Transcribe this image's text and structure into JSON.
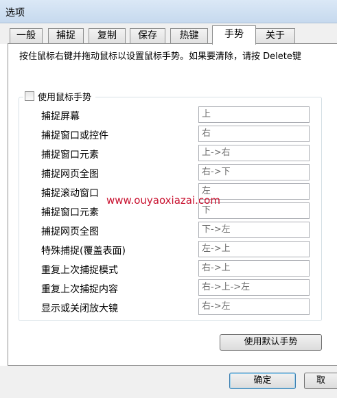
{
  "window": {
    "title": "选项"
  },
  "tabs": [
    {
      "label": "一般"
    },
    {
      "label": "捕捉"
    },
    {
      "label": "复制"
    },
    {
      "label": "保存"
    },
    {
      "label": "热键"
    },
    {
      "label": "手势"
    },
    {
      "label": "关于"
    }
  ],
  "active_tab": "手势",
  "gesture": {
    "description": "按住鼠标右键并拖动鼠标以设置鼠标手势。如果要清除，请按 Delete键",
    "enable_label": "使用鼠标手势",
    "enabled": false,
    "rows": [
      {
        "label": "捕捉屏幕",
        "value": "上"
      },
      {
        "label": "捕捉窗口或控件",
        "value": "右"
      },
      {
        "label": "捕捉窗口元素",
        "value": "上->右"
      },
      {
        "label": "捕捉网页全图",
        "value": "右->下"
      },
      {
        "label": "捕捉滚动窗口",
        "value": "左"
      },
      {
        "label": "捕捉窗口元素",
        "value": "下"
      },
      {
        "label": "捕捉网页全图",
        "value": "下->左"
      },
      {
        "label": "特殊捕捉(覆盖表面)",
        "value": "左->上"
      },
      {
        "label": "重复上次捕捉模式",
        "value": "右->上"
      },
      {
        "label": "重复上次捕捉内容",
        "value": "右->上->左"
      },
      {
        "label": "显示或关闭放大镜",
        "value": "右->左"
      }
    ],
    "default_button": "使用默认手势"
  },
  "watermark": "www.ouyaoxiazai.com",
  "footer": {
    "ok_label": "确定",
    "cancel_label": "取"
  }
}
